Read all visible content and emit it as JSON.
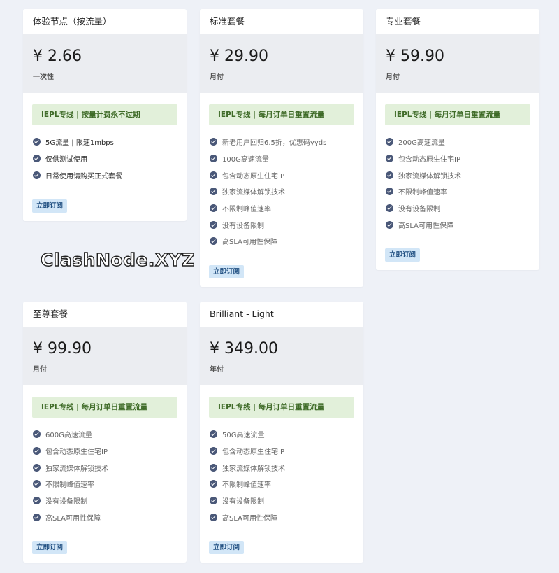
{
  "plans": [
    {
      "title": "体验节点（按流量）",
      "price": "¥ 2.66",
      "period": "一次性",
      "badge": "IEPL专线 | 按量计费永不过期",
      "features": [
        "5G流量 | 限速1mbps",
        "仅供测试使用",
        "日常使用请购买正式套餐"
      ],
      "button": "立即订阅"
    },
    {
      "title": "标准套餐",
      "price": "¥ 29.90",
      "period": "月付",
      "badge": "IEPL专线 | 每月订单日重置流量",
      "features": [
        "新老用户回归6.5折，优惠码yyds",
        "100G高速流量",
        "包含动态原生住宅IP",
        "独家流媒体解锁技术",
        "不限制峰值速率",
        "没有设备限制",
        "高SLA可用性保障"
      ],
      "button": "立即订阅"
    },
    {
      "title": "专业套餐",
      "price": "¥ 59.90",
      "period": "月付",
      "badge": "IEPL专线 | 每月订单日重置流量",
      "features": [
        "200G高速流量",
        "包含动态原生住宅IP",
        "独家流媒体解锁技术",
        "不限制峰值速率",
        "没有设备限制",
        "高SLA可用性保障"
      ],
      "button": "立即订阅"
    },
    {
      "title": "至尊套餐",
      "price": "¥ 99.90",
      "period": "月付",
      "badge": "IEPL专线 | 每月订单日重置流量",
      "features": [
        "600G高速流量",
        "包含动态原生住宅IP",
        "独家流媒体解锁技术",
        "不限制峰值速率",
        "没有设备限制",
        "高SLA可用性保障"
      ],
      "button": "立即订阅"
    },
    {
      "title": "Brilliant - Light",
      "price": "¥ 349.00",
      "period": "年付",
      "badge": "IEPL专线 | 每月订单日重置流量",
      "features": [
        "50G高速流量",
        "包含动态原生住宅IP",
        "独家流媒体解锁技术",
        "不限制峰值速率",
        "没有设备限制",
        "高SLA可用性保障"
      ],
      "button": "立即订阅"
    }
  ],
  "watermark": "ClashNode.XYZ",
  "icons": {
    "feature": "check-circle-icon"
  },
  "colors": {
    "badge_bg": "#e2f0da",
    "badge_text": "#3f6b28",
    "button_bg": "#d2e6f7",
    "button_text": "#1f4e80",
    "check": "#4a5878"
  }
}
